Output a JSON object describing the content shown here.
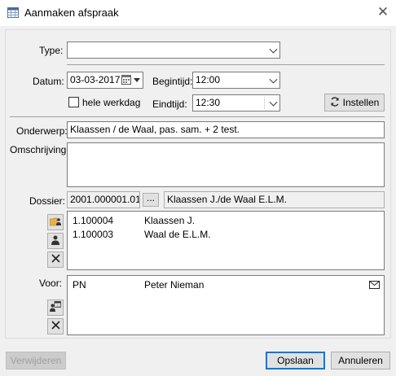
{
  "window": {
    "title": "Aanmaken afspraak",
    "close_glyph": "✕"
  },
  "form": {
    "type_label": "Type:",
    "type_value": "",
    "datum_label": "Datum:",
    "datum_value": "03-03-2017",
    "begintijd_label": "Begintijd:",
    "begintijd_value": "12:00",
    "hele_werkdag_label": "hele werkdag",
    "hele_werkdag_checked": false,
    "eindtijd_label": "Eindtijd:",
    "eindtijd_value": "12:30",
    "instellen_label": "Instellen",
    "onderwerp_label": "Onderwerp:",
    "onderwerp_value": "Klaassen / de Waal, pas. sam. + 2 test.",
    "omschrijving_label": "Omschrijving:",
    "omschrijving_value": "",
    "dossier_label": "Dossier:",
    "dossier_value": "2001.000001.01",
    "dossier_browse": "...",
    "dossier_name": "Klaassen J./de Waal E.L.M.",
    "voor_label": "Voor:"
  },
  "dossier_list": [
    {
      "code": "1.100004",
      "name": "Klaassen J."
    },
    {
      "code": "1.100003",
      "name": "Waal de E.L.M."
    }
  ],
  "voor_list": [
    {
      "code": "PN",
      "name": "Peter Nieman"
    }
  ],
  "footer": {
    "verwijderen_label": "Verwijderen",
    "opslaan_label": "Opslaan",
    "annuleren_label": "Annuleren"
  },
  "icons": [
    "calendar-icon",
    "close-icon",
    "chevron-down-icon",
    "refresh-icon",
    "folder-person-icon",
    "person-icon",
    "delete-x-icon",
    "calendar-person-icon",
    "mail-icon"
  ]
}
